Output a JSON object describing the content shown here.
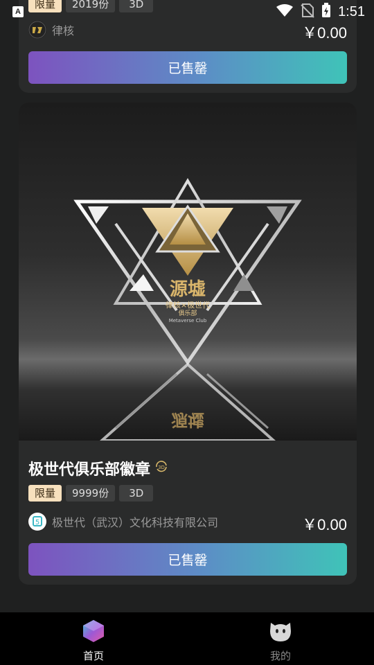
{
  "status_bar": {
    "time": "1:51",
    "left_icon": "a-notification-icon",
    "icons": [
      "wifi-icon",
      "no-sim-icon",
      "battery-charging-icon"
    ]
  },
  "cards": [
    {
      "tags": {
        "limited": "限量",
        "count": "2019份",
        "type": "3D"
      },
      "issuer": "律核",
      "price": "￥0.00",
      "button": "已售罄"
    },
    {
      "title": "极世代俱乐部徽章",
      "title_icon": "3d-rotate-icon",
      "artwork_text": {
        "main": "源墟",
        "sub": "律核×极世代",
        "sub2": "俱乐部",
        "en": "Metaverse Club"
      },
      "tags": {
        "limited": "限量",
        "count": "9999份",
        "type": "3D"
      },
      "issuer": "极世代（武汉）文化科技有限公司",
      "price": "￥0.00",
      "button": "已售罄"
    }
  ],
  "bottom_nav": [
    {
      "label": "首页",
      "icon": "cube-home-icon",
      "active": true
    },
    {
      "label": "我的",
      "icon": "cat-face-profile-icon",
      "active": false
    }
  ],
  "colors": {
    "background": "#1f2020",
    "card": "#2a2b2b",
    "limited_tag": "#f7e0bd",
    "button_gradient_start": "#7d53bf",
    "button_gradient_end": "#3fc3b8"
  }
}
